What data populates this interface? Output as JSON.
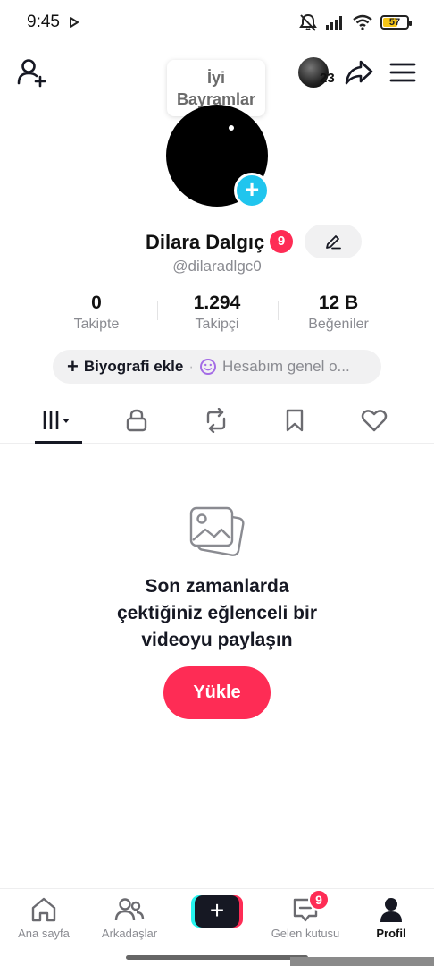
{
  "status_bar": {
    "time": "9:45",
    "battery": "57",
    "battery_level": 0.57
  },
  "header": {
    "greeting_line1": "İyi",
    "greeting_line2": "Bayramlar",
    "avatar_count": "23"
  },
  "profile": {
    "name": "Dilara Dalgıç",
    "name_badge": "9",
    "username": "@dilaradlgc0"
  },
  "stats": [
    {
      "value": "0",
      "label": "Takipte"
    },
    {
      "value": "1.294",
      "label": "Takipçi"
    },
    {
      "value": "12 B",
      "label": "Beğeniler"
    }
  ],
  "bio": {
    "add_label": "Biyografi ekle",
    "account_label": "Hesabım genel o..."
  },
  "tabs": [
    {
      "icon": "videos-grid-icon",
      "active": true
    },
    {
      "icon": "lock-icon"
    },
    {
      "icon": "repost-icon"
    },
    {
      "icon": "bookmark-icon"
    },
    {
      "icon": "heart-icon"
    }
  ],
  "empty_state": {
    "title_line1": "Son zamanlarda",
    "title_line2": "çektiğiniz eğlenceli bir",
    "title_line3": "videoyu paylaşın",
    "button": "Yükle"
  },
  "bottom_nav": {
    "home": "Ana sayfa",
    "friends": "Arkadaşlar",
    "inbox": "Gelen kutusu",
    "inbox_badge": "9",
    "profile": "Profil"
  },
  "colors": {
    "accent": "#fe2c55",
    "cyan": "#20c5ee",
    "text": "#161823",
    "muted": "#8a8b91"
  }
}
